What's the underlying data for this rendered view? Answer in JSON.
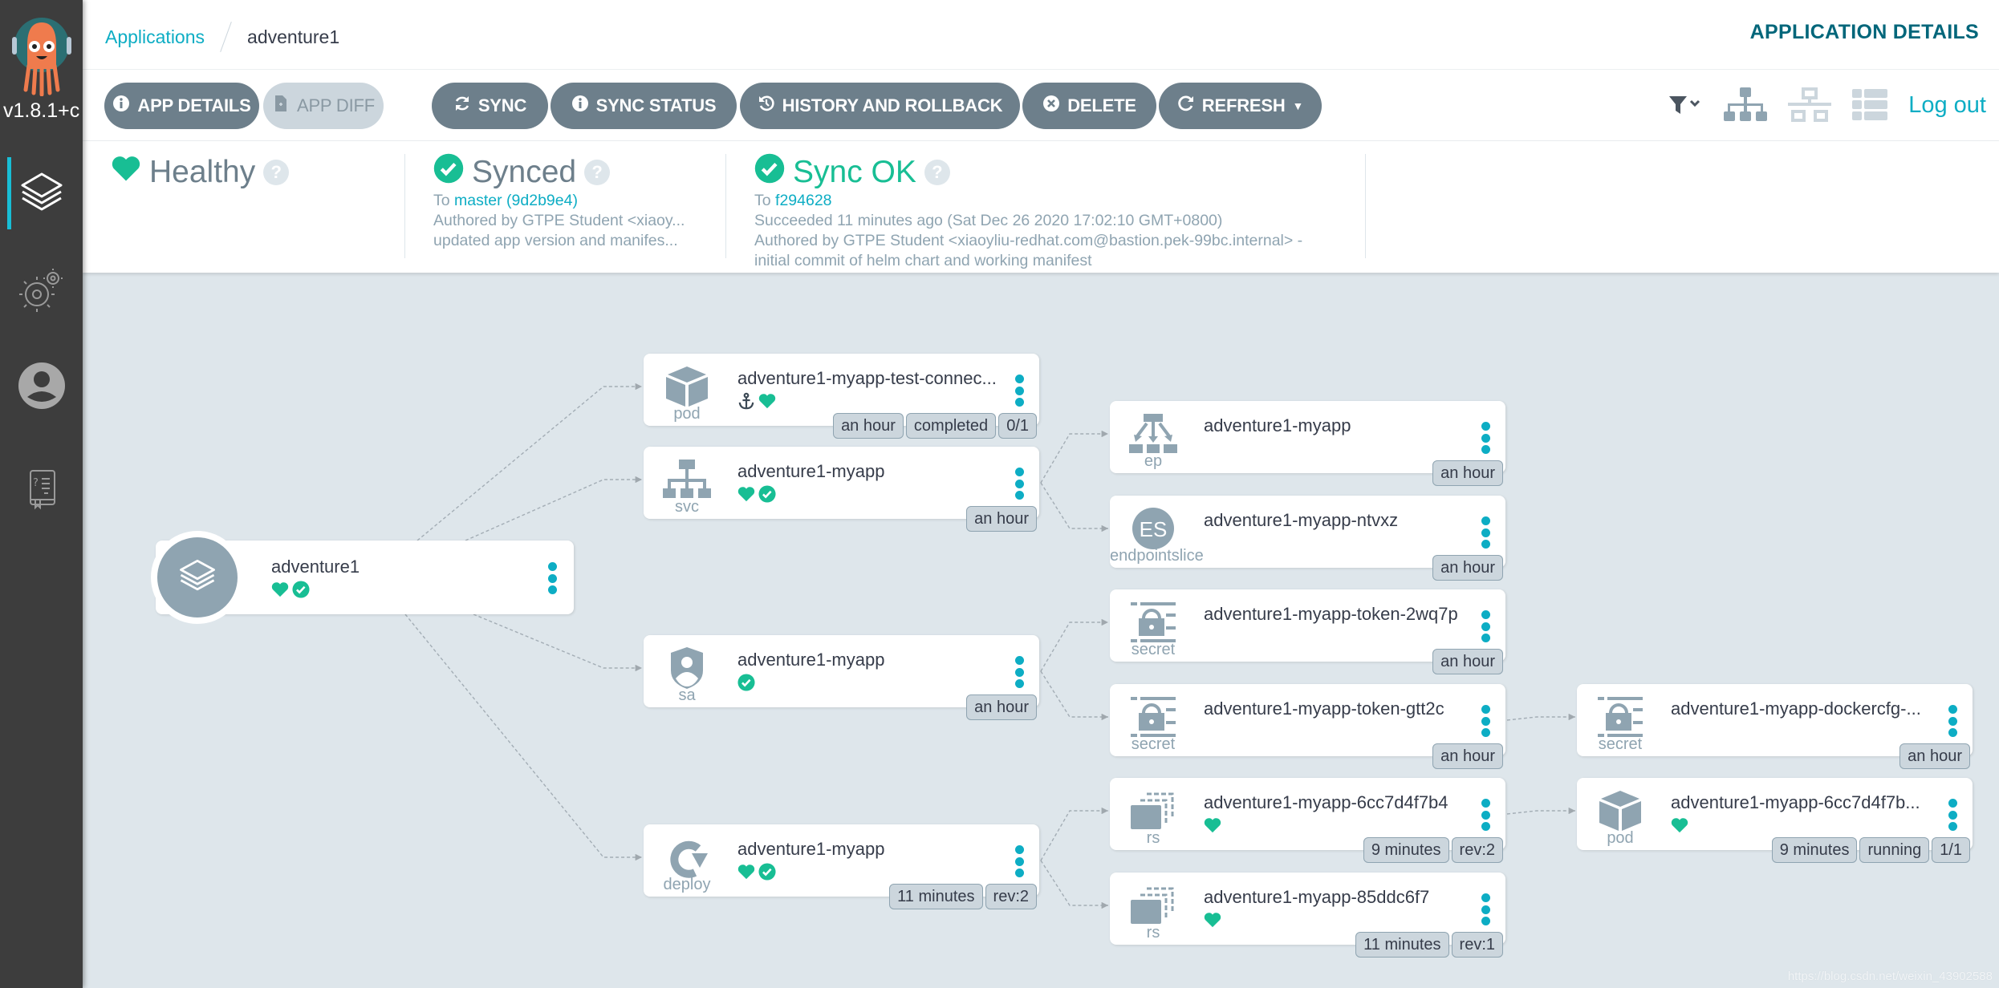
{
  "sidebar": {
    "version": "v1.8.1+c",
    "items": [
      {
        "name": "applications",
        "icon": "layers-icon",
        "active": true
      },
      {
        "name": "settings",
        "icon": "gears-icon",
        "active": false
      },
      {
        "name": "user-info",
        "icon": "user-circle-icon",
        "active": false
      },
      {
        "name": "docs",
        "icon": "help-book-icon",
        "active": false
      }
    ]
  },
  "header": {
    "breadcrumb": {
      "root": "Applications",
      "current": "adventure1"
    },
    "title": "APPLICATION DETAILS"
  },
  "toolbar": {
    "buttons": [
      {
        "label": "APP DETAILS",
        "icon": "info-circle-icon",
        "disabled": false
      },
      {
        "label": "APP DIFF",
        "icon": "file-diff-icon",
        "disabled": true
      },
      {
        "label": "SYNC",
        "icon": "sync-icon",
        "disabled": false
      },
      {
        "label": "SYNC STATUS",
        "icon": "info-circle-icon",
        "disabled": false
      },
      {
        "label": "HISTORY AND ROLLBACK",
        "icon": "history-icon",
        "disabled": false
      },
      {
        "label": "DELETE",
        "icon": "times-circle-icon",
        "disabled": false
      },
      {
        "label": "REFRESH",
        "icon": "redo-icon",
        "disabled": false,
        "dropdown": true
      }
    ],
    "logout": "Log out"
  },
  "status": {
    "health": {
      "title": "Healthy"
    },
    "sync": {
      "title": "Synced",
      "to_prefix": "To",
      "revision": "master (9d2b9e4)",
      "author": "Authored by GTPE Student <xiaoy...",
      "message": "updated app version and manifes..."
    },
    "operation": {
      "title": "Sync OK",
      "to_prefix": "To",
      "revision": "f294628",
      "succeeded": "Succeeded 11 minutes ago (Sat Dec 26 2020 17:02:10 GMT+0800)",
      "author": "Authored by GTPE Student <xiaoyliu-redhat.com@bastion.pek-99bc.internal> -",
      "message": "initial commit of helm chart and working manifest"
    }
  },
  "colors": {
    "accent": "#0dadc4",
    "healthy": "#18be94",
    "node_icon": "#8fa4b1",
    "button": "#6d7f8b",
    "sidebar": "#3d3d3d",
    "graph_bg": "#dee6eb"
  },
  "graph": {
    "app": {
      "name": "adventure1",
      "health": "healthy",
      "sync": "synced"
    },
    "nodes": [
      {
        "id": "pod-test",
        "kind": "pod",
        "name": "adventure1-myapp-test-connec...",
        "hook": true,
        "health": true,
        "synced": false,
        "tags": [
          "an hour",
          "completed",
          "0/1"
        ]
      },
      {
        "id": "svc",
        "kind": "svc",
        "name": "adventure1-myapp",
        "hook": false,
        "health": true,
        "synced": true,
        "tags": [
          "an hour"
        ]
      },
      {
        "id": "sa",
        "kind": "sa",
        "name": "adventure1-myapp",
        "hook": false,
        "health": false,
        "synced": true,
        "tags": [
          "an hour"
        ]
      },
      {
        "id": "deploy",
        "kind": "deploy",
        "name": "adventure1-myapp",
        "hook": false,
        "health": true,
        "synced": true,
        "tags": [
          "11 minutes",
          "rev:2"
        ]
      },
      {
        "id": "ep",
        "kind": "ep",
        "name": "adventure1-myapp",
        "hook": false,
        "health": false,
        "synced": false,
        "tags": [
          "an hour"
        ]
      },
      {
        "id": "es",
        "kind": "endpointslice",
        "name": "adventure1-myapp-ntvxz",
        "hook": false,
        "health": false,
        "synced": false,
        "tags": [
          "an hour"
        ]
      },
      {
        "id": "secret-2wq7p",
        "kind": "secret",
        "name": "adventure1-myapp-token-2wq7p",
        "hook": false,
        "health": false,
        "synced": false,
        "tags": [
          "an hour"
        ]
      },
      {
        "id": "secret-gtt2c",
        "kind": "secret",
        "name": "adventure1-myapp-token-gtt2c",
        "hook": false,
        "health": false,
        "synced": false,
        "tags": [
          "an hour"
        ]
      },
      {
        "id": "rs-6cc",
        "kind": "rs",
        "name": "adventure1-myapp-6cc7d4f7b4",
        "hook": false,
        "health": true,
        "synced": false,
        "tags": [
          "9 minutes",
          "rev:2"
        ]
      },
      {
        "id": "rs-85d",
        "kind": "rs",
        "name": "adventure1-myapp-85ddc6f7",
        "hook": false,
        "health": true,
        "synced": false,
        "tags": [
          "11 minutes",
          "rev:1"
        ]
      },
      {
        "id": "secret-docker",
        "kind": "secret",
        "name": "adventure1-myapp-dockercfg-...",
        "hook": false,
        "health": false,
        "synced": false,
        "tags": [
          "an hour"
        ]
      },
      {
        "id": "pod-6cc",
        "kind": "pod",
        "name": "adventure1-myapp-6cc7d4f7b...",
        "hook": false,
        "health": true,
        "synced": false,
        "tags": [
          "9 minutes",
          "running",
          "1/1"
        ]
      }
    ],
    "edges": [
      [
        "app",
        "pod-test"
      ],
      [
        "app",
        "svc"
      ],
      [
        "app",
        "sa"
      ],
      [
        "app",
        "deploy"
      ],
      [
        "svc",
        "ep"
      ],
      [
        "svc",
        "es"
      ],
      [
        "sa",
        "secret-2wq7p"
      ],
      [
        "sa",
        "secret-gtt2c"
      ],
      [
        "deploy",
        "rs-6cc"
      ],
      [
        "deploy",
        "rs-85d"
      ],
      [
        "secret-gtt2c",
        "secret-docker"
      ],
      [
        "rs-6cc",
        "pod-6cc"
      ]
    ]
  },
  "watermark": "https://blog.csdn.net/weixin_43902588"
}
